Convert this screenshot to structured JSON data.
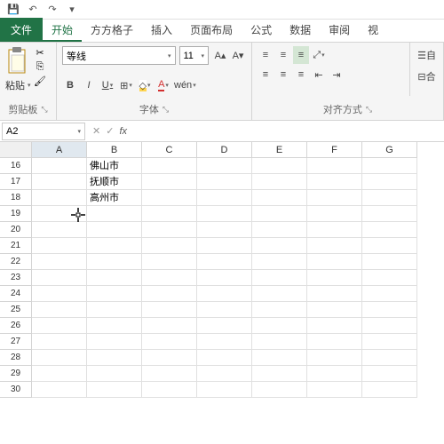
{
  "qat": {
    "save": "💾",
    "undo": "↶",
    "redo": "↷"
  },
  "tabs": {
    "file": "文件",
    "start": "开始",
    "fanggezi": "方方格子",
    "insert": "插入",
    "layout": "页面布局",
    "formula": "公式",
    "data": "数据",
    "review": "审阅",
    "view": "视"
  },
  "clipboard": {
    "paste": "粘贴",
    "label": "剪贴板"
  },
  "font": {
    "name": "等线",
    "size": "11",
    "label": "字体",
    "bold": "B",
    "italic": "I",
    "underline": "U",
    "wen": "wén"
  },
  "align": {
    "label": "对齐方式",
    "auto": "自",
    "he": "合"
  },
  "namebox": "A2",
  "cols": [
    "A",
    "B",
    "C",
    "D",
    "E",
    "F",
    "G"
  ],
  "rows": [
    16,
    17,
    18,
    19,
    20,
    21,
    22,
    23,
    24,
    25,
    26,
    27,
    28,
    29,
    30
  ],
  "cells": {
    "16": {
      "B": "佛山市"
    },
    "17": {
      "B": "抚顺市"
    },
    "18": {
      "B": "高州市"
    }
  }
}
